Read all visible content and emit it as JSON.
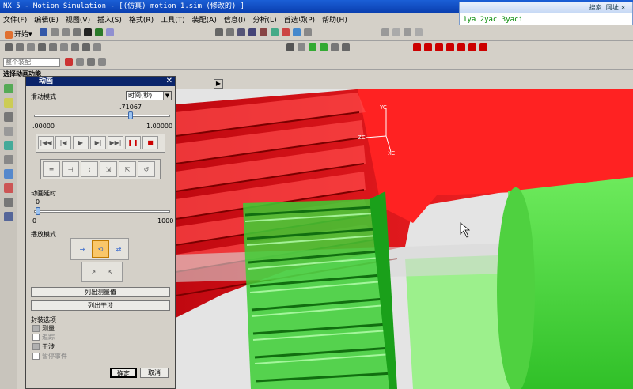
{
  "window": {
    "title": "NX 5 - Motion Simulation - [(仿真) motion_1.sim  (修改的) ]"
  },
  "menu": [
    "文件(F)",
    "编辑(E)",
    "视图(V)",
    "插入(S)",
    "格式(R)",
    "工具(T)",
    "装配(A)",
    "信息(I)",
    "分析(L)",
    "首选项(P)",
    "帮助(H)"
  ],
  "toolbar": {
    "start_label": "开始▾",
    "selection_filter": "整个装配",
    "status_text": "选择动画功能"
  },
  "search": {
    "button": "搜索",
    "site_label": "网址",
    "query": "1ya 2yac 3yaci"
  },
  "dialog": {
    "title": "动画",
    "slide_mode_label": "滑动模式",
    "slide_mode_value": "时间(秒)",
    "time_value": ".71067",
    "time_fraction": 0.71067,
    "time_min": ".00000",
    "time_max": "1.00000",
    "delay_label": "动画延时",
    "delay_value": "0",
    "delay_min": "0",
    "delay_max": "1000",
    "playback_label": "播放模式",
    "list_measure": "列出测量值",
    "list_interference": "列出干涉",
    "package_label": "封装选项",
    "options": [
      {
        "label": "测量",
        "checked": true,
        "enabled": true
      },
      {
        "label": "追踪",
        "checked": false,
        "enabled": false
      },
      {
        "label": "干涉",
        "checked": true,
        "enabled": true
      },
      {
        "label": "暂停事件",
        "checked": false,
        "enabled": false
      }
    ],
    "ok": "确定",
    "cancel": "取消"
  },
  "csys": {
    "yc": "YC",
    "zc": "ZC",
    "xc": "XC"
  },
  "colors": {
    "red_gear": "#e8141a",
    "green_gear": "#39d132",
    "shaft": "#5ee24c",
    "dialog_title": "#0a246a"
  }
}
